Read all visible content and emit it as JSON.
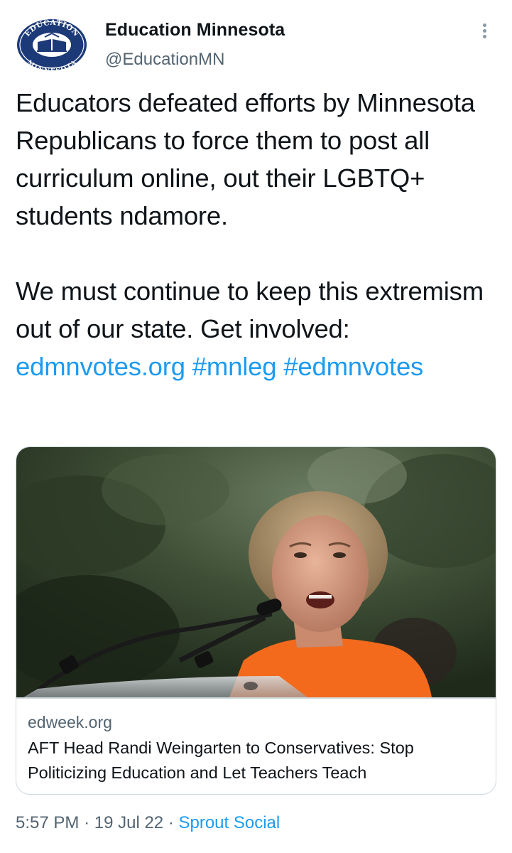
{
  "author": {
    "display_name": "Education Minnesota",
    "handle": "@EducationMN",
    "avatar_text_top": "EDUCATION",
    "avatar_text_bottom": "MINNESOTA",
    "avatar_color": "#1d3a78"
  },
  "tweet": {
    "paragraph1": "Educators defeated efforts by Minnesota Republicans to force them to post all curriculum online, out their LGBTQ+ students  ndamore.",
    "paragraph2_text": "We must continue to keep this extremism out of our state. Get involved: ",
    "link_url": "edmnvotes.org",
    "hashtag1": "#mnleg",
    "hashtag2": "#edmnvotes"
  },
  "card": {
    "domain": "edweek.org",
    "title": "AFT Head Randi Weingarten to Conservatives: Stop Politicizing Education and Let Teachers Teach"
  },
  "meta": {
    "time": "5:57 PM",
    "separator": "·",
    "date": "19 Jul 22",
    "source": "Sprout Social"
  },
  "colors": {
    "link": "#1d9bf0",
    "secondary_text": "#536471",
    "border": "#cfd9de",
    "shirt": "#f36a1c"
  },
  "icons": {
    "more": "more-vertical-icon"
  }
}
